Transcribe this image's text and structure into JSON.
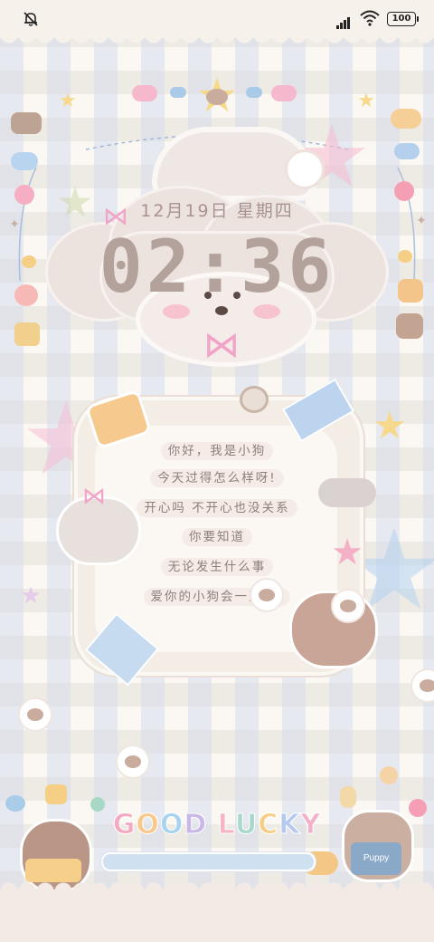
{
  "status_bar": {
    "battery": "100",
    "mute_icon": "ringer-muted-icon",
    "signal_icon": "cellular-signal-icon",
    "wifi_icon": "wifi-icon"
  },
  "clock": {
    "date": "12月19日 星期四",
    "time": "02:36"
  },
  "message": {
    "lines": [
      "你好，我是小狗",
      "今天过得怎么样呀!",
      "开心吗 不开心也没关系",
      "你要知道",
      "无论发生什么事",
      "爱你的小狗会一直在!"
    ]
  },
  "footer": {
    "slogan_letters": [
      "G",
      "O",
      "O",
      "D",
      " ",
      "L",
      "U",
      "C",
      "K",
      "Y"
    ],
    "slogan_colors": [
      "#f4a9c2",
      "#f9c98b",
      "#a8d3ee",
      "#c9b7e8",
      "#ffffff",
      "#f6b4c5",
      "#a7d8c9",
      "#f5cf86",
      "#b5c9ef",
      "#f3b0c9"
    ],
    "mug_label": "Puppy"
  },
  "colors": {
    "accent_pink": "#f2a4c8",
    "clock_text": "#b3a29c",
    "message_text": "#8e7f7c",
    "bar_blue": "#cfe0f0"
  }
}
